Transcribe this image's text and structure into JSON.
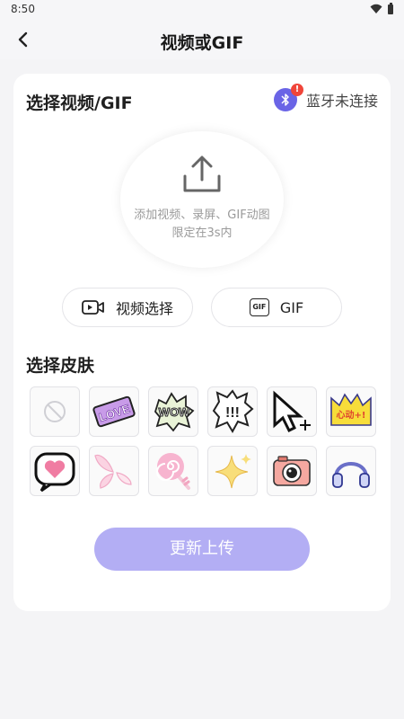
{
  "status_bar": {
    "time": "8:50"
  },
  "header": {
    "title": "视频或GIF"
  },
  "video_section": {
    "title": "选择视频/GIF",
    "bluetooth_status": "蓝牙未连接",
    "bluetooth_badge": "!",
    "upload_hint_line1": "添加视频、录屏、GIF动图",
    "upload_hint_line2": "限定在3s内",
    "video_button_label": "视频选择",
    "gif_button_label": "GIF",
    "gif_icon_text": "GIF"
  },
  "skin_section": {
    "title": "选择皮肤",
    "skins": [
      {
        "name": "none",
        "text": ""
      },
      {
        "name": "love",
        "text": "LOVE"
      },
      {
        "name": "wow",
        "text": "WOW"
      },
      {
        "name": "exclaim",
        "text": "!!!"
      },
      {
        "name": "cursor",
        "text": ""
      },
      {
        "name": "heartbeat",
        "text": "心动+!"
      },
      {
        "name": "heart-bubble",
        "text": ""
      },
      {
        "name": "wings",
        "text": ""
      },
      {
        "name": "lollipop",
        "text": ""
      },
      {
        "name": "sparkle",
        "text": ""
      },
      {
        "name": "camera",
        "text": ""
      },
      {
        "name": "headphones",
        "text": ""
      }
    ]
  },
  "footer": {
    "update_upload_label": "更新上传"
  },
  "colors": {
    "accent": "#6a64e6",
    "upload_button": "#b3aef4",
    "badge": "#f0453a"
  }
}
